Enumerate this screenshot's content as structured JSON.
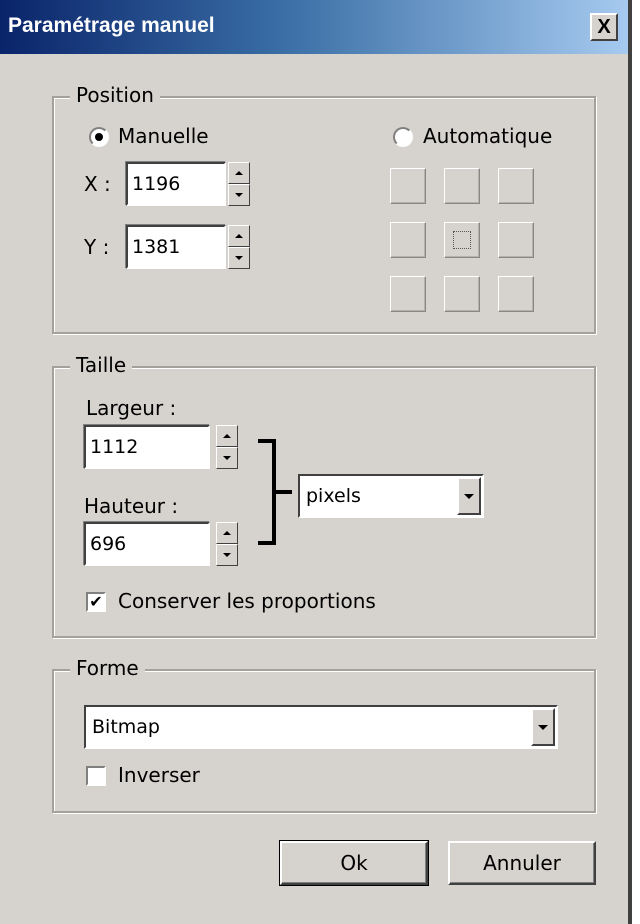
{
  "window": {
    "title": "Paramétrage manuel",
    "close_glyph": "X"
  },
  "position": {
    "legend": "Position",
    "manual_label": "Manuelle",
    "manual_selected": true,
    "auto_label": "Automatique",
    "auto_selected": false,
    "x_label": "X :",
    "x_value": "1196",
    "y_label": "Y :",
    "y_value": "1381"
  },
  "size": {
    "legend": "Taille",
    "width_label": "Largeur :",
    "width_value": "1112",
    "height_label": "Hauteur :",
    "height_value": "696",
    "unit": "pixels",
    "keep_ratio_label": "Conserver les proportions",
    "keep_ratio_checked": true,
    "check_glyph": "✔"
  },
  "shape": {
    "legend": "Forme",
    "value": "Bitmap",
    "invert_label": "Inverser",
    "invert_checked": false
  },
  "buttons": {
    "ok": "Ok",
    "cancel": "Annuler"
  },
  "icons": [
    "close-icon",
    "spin-up-icon",
    "spin-down-icon",
    "dropdown-arrow-icon",
    "checkmark-icon"
  ]
}
